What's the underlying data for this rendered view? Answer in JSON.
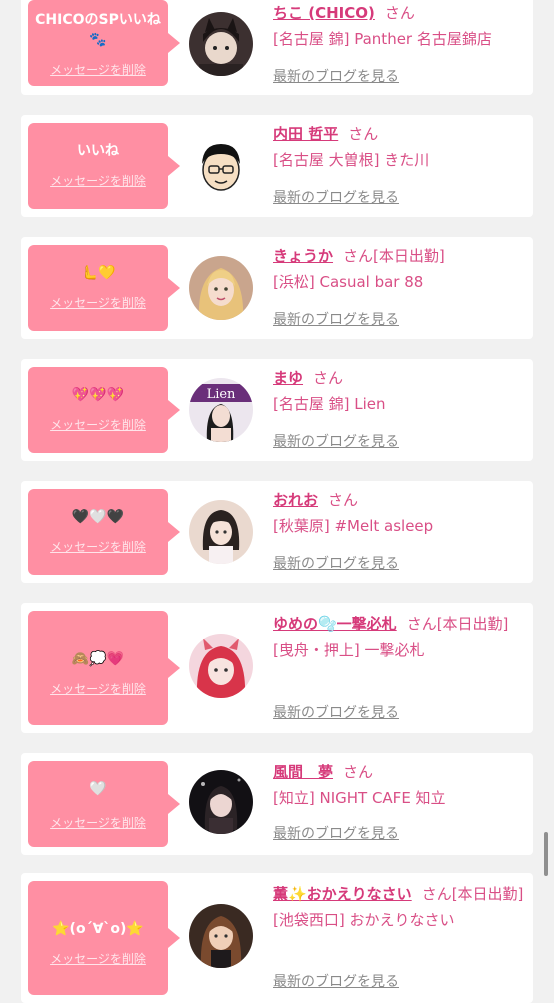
{
  "cards": [
    {
      "message": "CHICOのSPいいね🐾",
      "delete_label": "メッセージを削除",
      "name": "ちこ (CHICO)",
      "san": "さん",
      "status": "",
      "shop": "[名古屋 錦] Panther 名古屋錦店",
      "blog_label": "最新のブログを見る",
      "avatar_icon": "cat-girl-avatar-icon"
    },
    {
      "message": "いいね",
      "delete_label": "メッセージを削除",
      "name": "内田 哲平",
      "san": "さん",
      "status": "",
      "shop": "[名古屋 大曽根] きた川",
      "blog_label": "最新のブログを見る",
      "avatar_icon": "cartoon-man-avatar-icon"
    },
    {
      "message": "🫷💛",
      "delete_label": "メッセージを削除",
      "name": "きょうか",
      "san": "さん",
      "status": "[本日出勤]",
      "shop": "[浜松] Casual bar 88",
      "blog_label": "最新のブログを見る",
      "avatar_icon": "blonde-woman-avatar-icon"
    },
    {
      "message": "💖💖💖",
      "delete_label": "メッセージを削除",
      "name": "まゆ",
      "san": "さん",
      "status": "",
      "shop": "[名古屋 錦] Lien",
      "blog_label": "最新のブログを見る",
      "avatar_icon": "lien-woman-avatar-icon"
    },
    {
      "message": "🖤🤍🖤",
      "delete_label": "メッセージを削除",
      "name": "おれお",
      "san": "さん",
      "status": "",
      "shop": "[秋葉原] #Melt asleep",
      "blog_label": "最新のブログを見る",
      "avatar_icon": "dark-hair-woman-avatar-icon"
    },
    {
      "message": "🙈💭💗",
      "delete_label": "メッセージを削除",
      "name": "ゆめの🫧一撃必札",
      "san": "さん",
      "status": "[本日出勤]",
      "shop": "[曳舟・押上] 一撃必札",
      "blog_label": "最新のブログを見る",
      "avatar_icon": "red-hair-woman-avatar-icon"
    },
    {
      "message": "🤍",
      "delete_label": "メッセージを削除",
      "name": "風間　夢",
      "san": "さん",
      "status": "",
      "shop": "[知立] NIGHT CAFE 知立",
      "blog_label": "最新のブログを見る",
      "avatar_icon": "night-woman-avatar-icon"
    },
    {
      "message": "⭐(o´∀`o)⭐",
      "delete_label": "メッセージを削除",
      "name": "薫✨おかえりなさい",
      "san": "さん",
      "status": "[本日出勤]",
      "shop": "[池袋西口] おかえりなさい",
      "blog_label": "最新のブログを見る",
      "avatar_icon": "brunette-woman-avatar-icon"
    }
  ],
  "colors": {
    "page_bg": "#f1f1f1",
    "card_bg": "#ffffff",
    "bubble_bg": "#ff8fa3",
    "name": "#d63a7a",
    "shop": "#d94f86",
    "blog_link": "#8a8a8a"
  }
}
